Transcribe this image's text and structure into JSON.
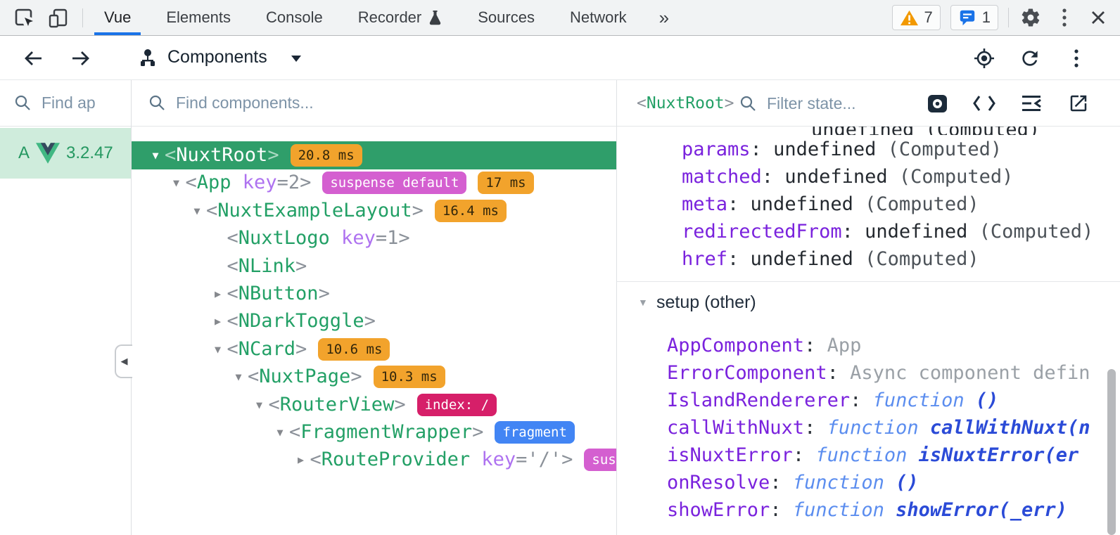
{
  "colors": {
    "accent_blue": "#1a73e8",
    "vue_green": "#23a066",
    "selected_row_green": "#2f9e6a",
    "perf_badge_orange": "#f2a32c",
    "suspense_badge_magenta": "#d45fd0",
    "route_badge_crimson": "#d61f69",
    "fragment_badge_blue": "#4285f4",
    "state_key_purple": "#7a22dd",
    "app_row_mint": "#cfecdc"
  },
  "glyphs": {
    "caret_down": "▼",
    "caret_right": "▶",
    "collapse_left": "◀",
    "overflow": "»",
    "dots": "⋮"
  },
  "topbar": {
    "tabs": [
      {
        "label": "Vue",
        "active": true
      },
      {
        "label": "Elements"
      },
      {
        "label": "Console"
      },
      {
        "label": "Recorder",
        "icon": "flask"
      },
      {
        "label": "Sources"
      },
      {
        "label": "Network"
      }
    ],
    "warning_count": "7",
    "message_count": "1"
  },
  "vue_toolbar": {
    "title": "Components"
  },
  "left_panel": {
    "search_placeholder": "Find ap",
    "app_name_fragment": "A",
    "app_version": "3.2.47"
  },
  "components_panel": {
    "search_placeholder": "Find components...",
    "tree": [
      {
        "level": 0,
        "arrow": "down",
        "tag": "NuxtRoot",
        "selected": true,
        "badges": [
          {
            "text": "20.8 ms",
            "type": "perf"
          }
        ]
      },
      {
        "level": 1,
        "arrow": "down",
        "tag": "App",
        "attr": "key",
        "attr_value": "=2",
        "badges": [
          {
            "text": "suspense default",
            "type": "suspense"
          },
          {
            "text": "17 ms",
            "type": "perf"
          }
        ]
      },
      {
        "level": 2,
        "arrow": "down",
        "tag": "NuxtExampleLayout",
        "badges": [
          {
            "text": "16.4 ms",
            "type": "perf"
          }
        ]
      },
      {
        "level": 3,
        "arrow": "none",
        "tag": "NuxtLogo",
        "attr": "key",
        "attr_value": "=1"
      },
      {
        "level": 3,
        "arrow": "none",
        "tag": "NLink"
      },
      {
        "level": 3,
        "arrow": "right",
        "tag": "NButton"
      },
      {
        "level": 3,
        "arrow": "right",
        "tag": "NDarkToggle"
      },
      {
        "level": 3,
        "arrow": "down",
        "tag": "NCard",
        "badges": [
          {
            "text": "10.6 ms",
            "type": "perf"
          }
        ]
      },
      {
        "level": 4,
        "arrow": "down",
        "tag": "NuxtPage",
        "badges": [
          {
            "text": "10.3 ms",
            "type": "perf"
          }
        ]
      },
      {
        "level": 5,
        "arrow": "down",
        "tag": "RouterView",
        "badges": [
          {
            "text": "index: /",
            "type": "route"
          }
        ]
      },
      {
        "level": 6,
        "arrow": "down",
        "tag": "FragmentWrapper",
        "badges": [
          {
            "text": "fragment",
            "type": "fragment"
          }
        ]
      },
      {
        "level": 7,
        "arrow": "right",
        "tag": "RouteProvider",
        "attr": "key",
        "attr_value": "='/'",
        "badges": [
          {
            "text": "suspense default",
            "type": "suspense"
          }
        ]
      }
    ]
  },
  "state_panel": {
    "selected_tag": "NuxtRoot",
    "filter_placeholder": "Filter state...",
    "clipped_top_text": "undefined (Computed)",
    "computed_fields": [
      {
        "key": "params",
        "value": "undefined",
        "meta": "(Computed)"
      },
      {
        "key": "matched",
        "value": "undefined",
        "meta": "(Computed)"
      },
      {
        "key": "meta",
        "value": "undefined",
        "meta": "(Computed)"
      },
      {
        "key": "redirectedFrom",
        "value": "undefined",
        "meta": "(Computed)"
      },
      {
        "key": "href",
        "value": "undefined",
        "meta": "(Computed)"
      }
    ],
    "section_title": "setup (other)",
    "setup_fields": [
      {
        "key": "AppComponent",
        "kind": "muted",
        "value": "App"
      },
      {
        "key": "ErrorComponent",
        "kind": "muted",
        "value": "Async component defin"
      },
      {
        "key": "IslandRendererer",
        "kind": "function",
        "keyword": "function",
        "fname": "()"
      },
      {
        "key": "callWithNuxt",
        "kind": "function",
        "keyword": "function",
        "fname": "callWithNuxt(n"
      },
      {
        "key": "isNuxtError",
        "kind": "function",
        "keyword": "function",
        "fname": "isNuxtError(er"
      },
      {
        "key": "onResolve",
        "kind": "function",
        "keyword": "function",
        "fname": "()"
      },
      {
        "key": "showError",
        "kind": "function",
        "keyword": "function",
        "fname": "showError(_err)"
      }
    ]
  }
}
